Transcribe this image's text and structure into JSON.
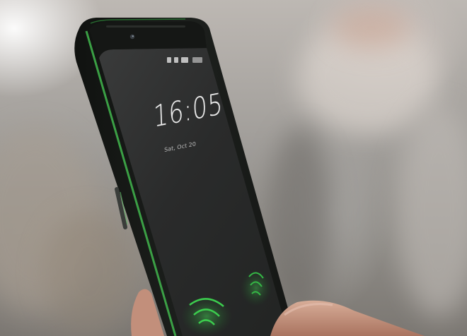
{
  "photo": {
    "subject": "smartphone lock screen held in hand",
    "colors": {
      "frame": "#1a1d1a",
      "accent_trim": "#3fae4a",
      "screen": "#2b2c2c",
      "glow": "#39c24a",
      "skin": "#c99a86"
    }
  },
  "lock_screen": {
    "time": "16:05",
    "date": "Sat, Oct 20"
  },
  "icons": {
    "front_camera": "front-camera-icon",
    "status_bar": "status-bar-icons",
    "fingerprint": "fingerprint-glow-icon",
    "side_button": "side-button"
  }
}
